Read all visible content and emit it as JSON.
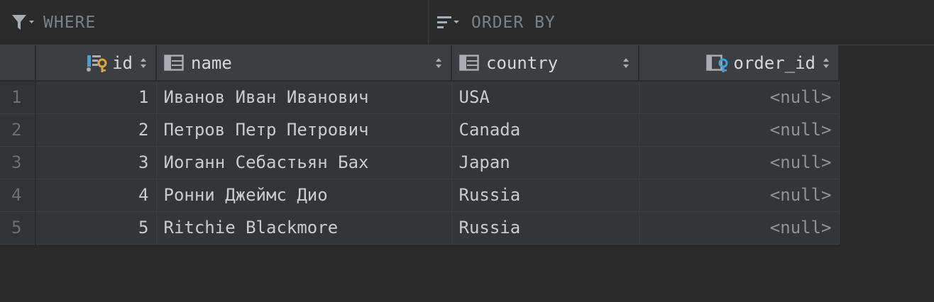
{
  "filter": {
    "where_label": "WHERE",
    "order_label": "ORDER BY",
    "where_icon": "filter-icon",
    "order_icon": "sort-lines-icon"
  },
  "columns": [
    {
      "label": "id",
      "icon": "primary-key-column-icon",
      "align": "right"
    },
    {
      "label": "name",
      "icon": "table-column-icon",
      "align": "left"
    },
    {
      "label": "country",
      "icon": "table-column-icon",
      "align": "left"
    },
    {
      "label": "order_id",
      "icon": "foreign-key-column-icon",
      "align": "right"
    }
  ],
  "rows": [
    {
      "rownum": "1",
      "id": "1",
      "name": "Иванов Иван Иванович",
      "country": "USA",
      "order_id": "<null>"
    },
    {
      "rownum": "2",
      "id": "2",
      "name": "Петров Петр Петрович",
      "country": "Canada",
      "order_id": "<null>"
    },
    {
      "rownum": "3",
      "id": "3",
      "name": "Иоганн Себастьян Бах",
      "country": "Japan",
      "order_id": "<null>"
    },
    {
      "rownum": "4",
      "id": "4",
      "name": "Ронни Джеймс Дио",
      "country": "Russia",
      "order_id": "<null>"
    },
    {
      "rownum": "5",
      "id": "5",
      "name": "Ritchie Blackmore",
      "country": "Russia",
      "order_id": "<null>"
    }
  ],
  "colors": {
    "background": "#2b2b2b",
    "header_bg": "#3c3f41",
    "cell_bg": "#333537",
    "key_gold": "#e0a73a",
    "key_blue": "#3fa2d8",
    "icon_gray": "#a9acb0"
  }
}
